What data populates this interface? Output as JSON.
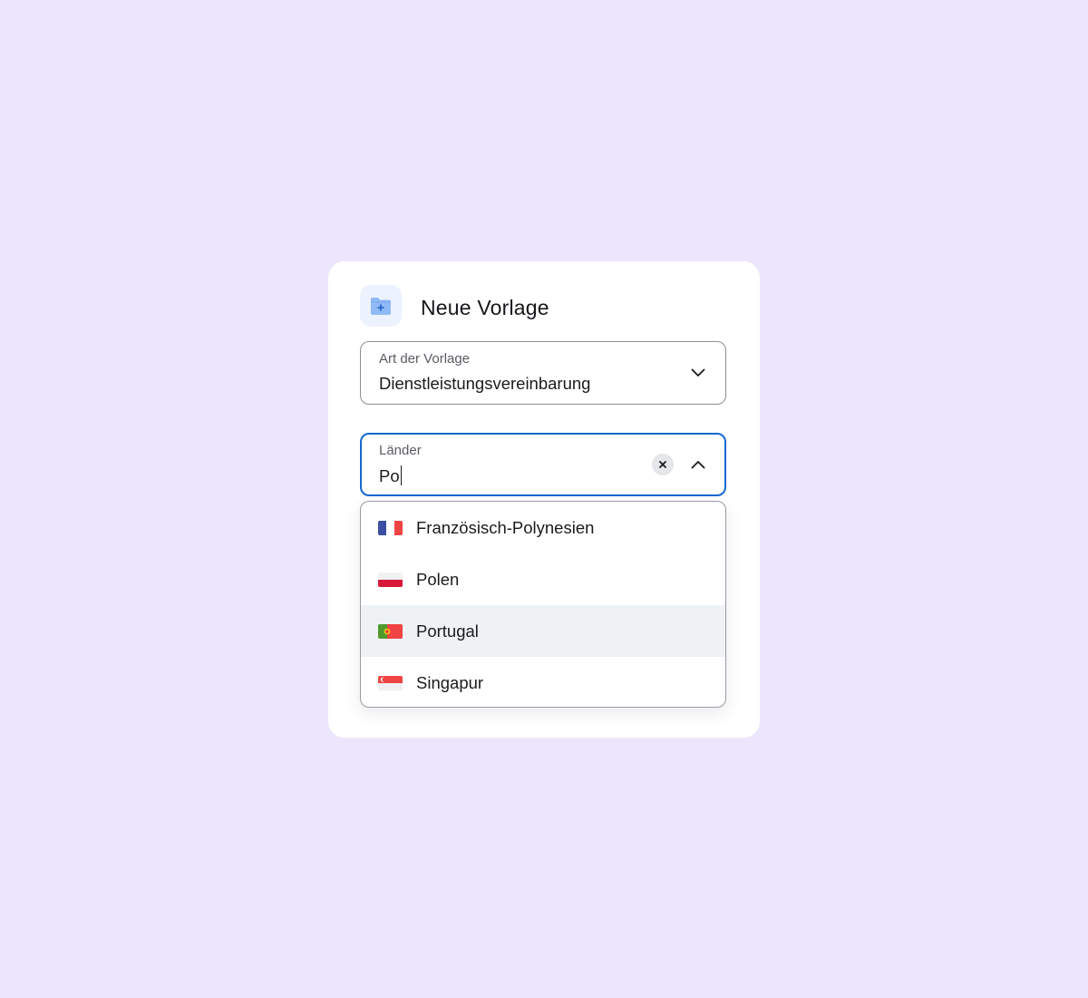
{
  "dialog": {
    "title": "Neue Vorlage",
    "icon": "folder-add-icon"
  },
  "template_type": {
    "label": "Art der Vorlage",
    "value": "Dienstleistungsvereinbarung",
    "icon": "chevron-down-icon"
  },
  "countries": {
    "label": "Länder",
    "value": "Po",
    "clear_icon": "close-icon",
    "toggle_icon": "chevron-up-icon",
    "focus_color": "#1668d2"
  },
  "dropdown": {
    "highlight_color": "#eef2f5",
    "options": [
      {
        "label": "Französisch-Polynesien",
        "flag": "flag-french-polynesia",
        "highlighted": false
      },
      {
        "label": "Polen",
        "flag": "flag-poland",
        "highlighted": false
      },
      {
        "label": "Portugal",
        "flag": "flag-portugal",
        "highlighted": true
      },
      {
        "label": "Singapur",
        "flag": "flag-singapore",
        "highlighted": false
      }
    ]
  },
  "colors": {
    "background": "#ece6fd",
    "card": "#ffffff",
    "icon_badge": "#ecf3fe",
    "icon_accent": "#8fbaf5"
  }
}
